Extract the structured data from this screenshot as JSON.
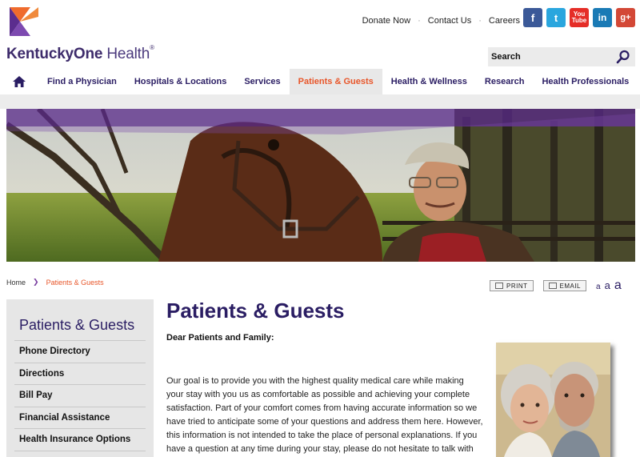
{
  "header": {
    "logo": {
      "brand": "KentuckyOne",
      "brand_suffix": "Health",
      "mark": "®"
    },
    "top_links": [
      "Donate Now",
      "Contact Us",
      "Careers"
    ],
    "social": [
      {
        "name": "facebook-icon",
        "glyph": "f"
      },
      {
        "name": "twitter-icon",
        "glyph": "t"
      },
      {
        "name": "youtube-icon",
        "glyph_top": "You",
        "glyph_bottom": "Tube"
      },
      {
        "name": "linkedin-icon",
        "glyph": "in"
      },
      {
        "name": "google-plus-icon",
        "glyph": "g+"
      }
    ],
    "search": {
      "label": "Search"
    }
  },
  "nav": {
    "items": [
      "Find a Physician",
      "Hospitals & Locations",
      "Services",
      "Patients & Guests",
      "Health & Wellness",
      "Research",
      "Health Professionals"
    ],
    "active_index": 3
  },
  "breadcrumb": {
    "home": "Home",
    "separator": "❯",
    "current": "Patients & Guests"
  },
  "tools": {
    "print": "PRINT",
    "email": "EMAIL",
    "text_sizes": [
      "a",
      "a",
      "a"
    ]
  },
  "sidebar": {
    "title": "Patients & Guests",
    "items": [
      "Phone Directory",
      "Directions",
      "Bill Pay",
      "Financial Assistance",
      "Health Insurance Options"
    ]
  },
  "main": {
    "title": "Patients & Guests",
    "greeting": "Dear Patients and Family:",
    "body": "Our goal is to provide you with the highest quality medical care while making your stay with you us as comfortable as possible and achieving your complete satisfaction. Part of your comfort comes from having accurate information so we have tried to anticipate some of your questions and address them here. However, this information is not intended to take the place of personal explanations. If you have a question at any time during your stay, please do not hesitate to talk with"
  },
  "colors": {
    "brand_purple": "#2a1d63",
    "accent_orange": "#e8562a",
    "nav_active_bg": "#e8e8e8",
    "sidebar_bg": "#e6e6e6"
  }
}
